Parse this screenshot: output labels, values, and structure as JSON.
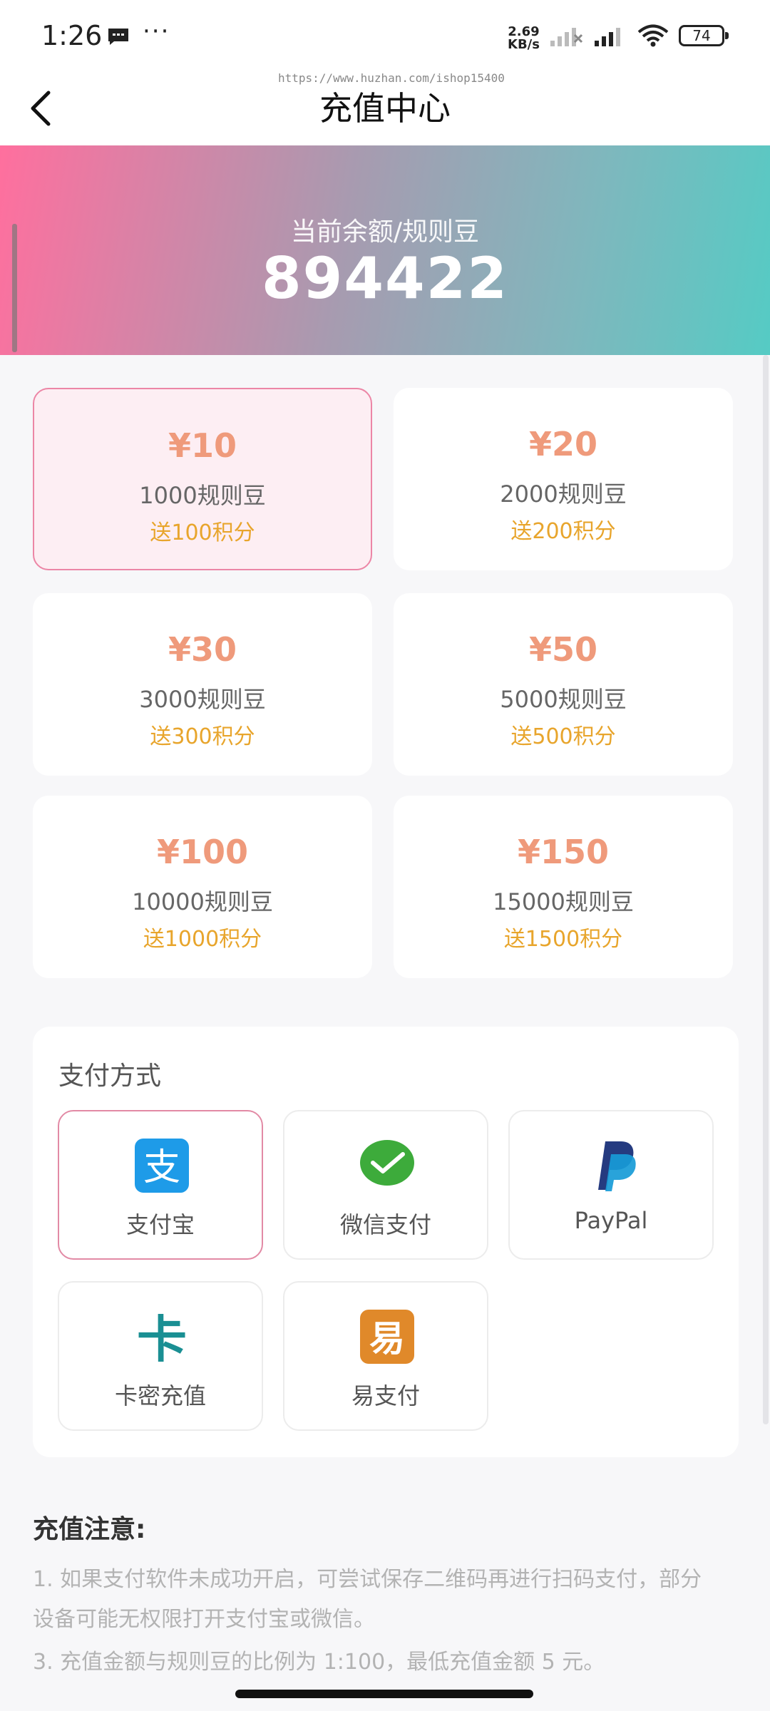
{
  "status_bar": {
    "time": "1:26",
    "more": "···",
    "speed_value": "2.69",
    "speed_unit": "KB/s",
    "battery": "74"
  },
  "nav": {
    "title": "充值中心",
    "watermark": "https://www.huzhan.com/ishop15400"
  },
  "balance": {
    "label": "当前余额/规则豆",
    "value": "894422"
  },
  "amounts": [
    {
      "price": "¥10",
      "beans": "1000规则豆",
      "bonus": "送100积分"
    },
    {
      "price": "¥20",
      "beans": "2000规则豆",
      "bonus": "送200积分"
    },
    {
      "price": "¥30",
      "beans": "3000规则豆",
      "bonus": "送300积分"
    },
    {
      "price": "¥50",
      "beans": "5000规则豆",
      "bonus": "送500积分"
    },
    {
      "price": "¥100",
      "beans": "10000规则豆",
      "bonus": "送1000积分"
    },
    {
      "price": "¥150",
      "beans": "15000规则豆",
      "bonus": "送1500积分"
    }
  ],
  "payment": {
    "title": "支付方式",
    "methods": [
      {
        "label": "支付宝",
        "icon": "alipay-icon"
      },
      {
        "label": "微信支付",
        "icon": "wechat-pay-icon"
      },
      {
        "label": "PayPal",
        "icon": "paypal-icon"
      },
      {
        "label": "卡密充值",
        "icon": "card-key-icon"
      },
      {
        "label": "易支付",
        "icon": "yipay-icon"
      }
    ]
  },
  "notice": {
    "title": "充值注意:",
    "lines": [
      "1. 如果支付软件未成功开启，可尝试保存二维码再进行扫码支付，部分",
      "设备可能无权限打开支付宝或微信。",
      "3. 充值金额与规则豆的比例为 1:100，最低充值金额 5 元。"
    ]
  },
  "colors": {
    "accent_pink": "#ec86a6",
    "price": "#ef9a7b",
    "bonus": "#e8a52c",
    "banner_start": "#ff6f9e",
    "banner_end": "#55cbc4"
  }
}
